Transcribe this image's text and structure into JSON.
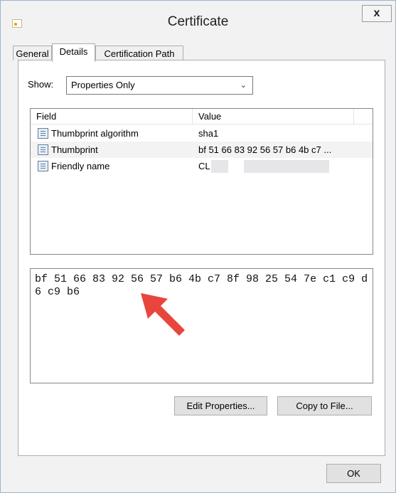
{
  "window": {
    "title": "Certificate",
    "close_label": "x"
  },
  "tabs": [
    {
      "label": "General",
      "active": false
    },
    {
      "label": "Details",
      "active": true
    },
    {
      "label": "Certification Path",
      "active": false
    }
  ],
  "show": {
    "label": "Show:",
    "selected": "Properties Only"
  },
  "list": {
    "columns": [
      "Field",
      "Value"
    ],
    "rows": [
      {
        "field": "Thumbprint algorithm",
        "value": "sha1",
        "selected": false
      },
      {
        "field": "Thumbprint",
        "value": "bf 51 66 83 92 56 57 b6 4b c7 ...",
        "selected": true
      },
      {
        "field": "Friendly name",
        "value": "CL",
        "selected": false
      }
    ]
  },
  "detail_text": "bf 51 66 83 92 56 57 b6 4b c7 8f 98 25 54 7e c1 c9 d6 c9 b6",
  "buttons": {
    "edit_properties": "Edit Properties...",
    "copy_to_file": "Copy to File...",
    "ok": "OK"
  },
  "colors": {
    "annotation_arrow": "#e8453c",
    "selected_row": "#f3f3f3"
  }
}
